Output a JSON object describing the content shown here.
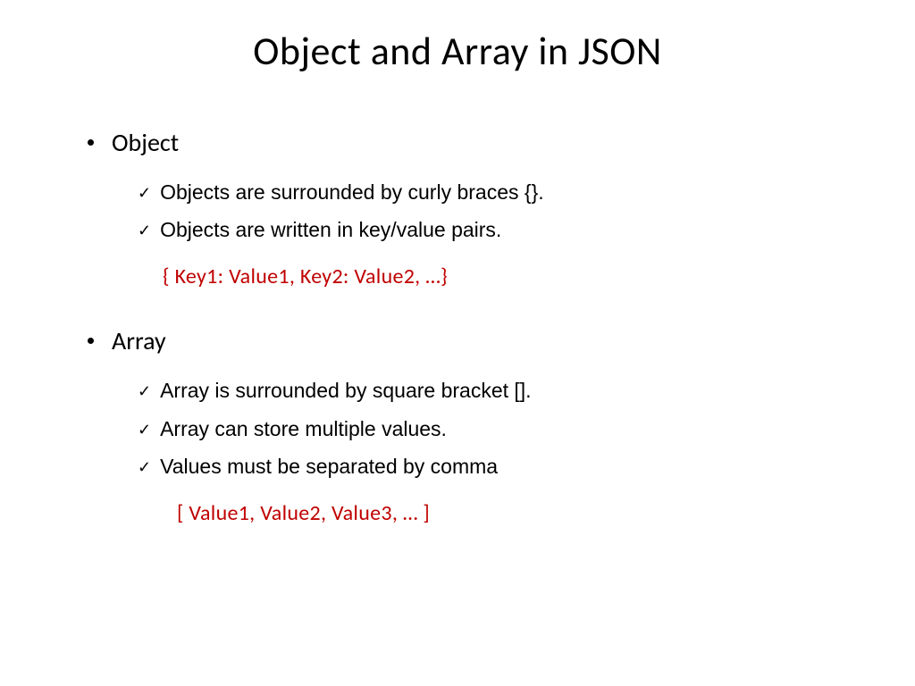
{
  "title": "Object and Array in JSON",
  "object": {
    "heading": "Object",
    "points": [
      "Objects are surrounded by curly braces {}.",
      "Objects are written in key/value pairs."
    ],
    "example": "{ Key1: Value1, Key2: Value2, …}"
  },
  "array": {
    "heading": "Array",
    "points": [
      "Array is surrounded by square bracket [].",
      "Array can store multiple values.",
      "Values must be separated by comma"
    ],
    "example": "[ Value1, Value2, Value3, … ]"
  }
}
